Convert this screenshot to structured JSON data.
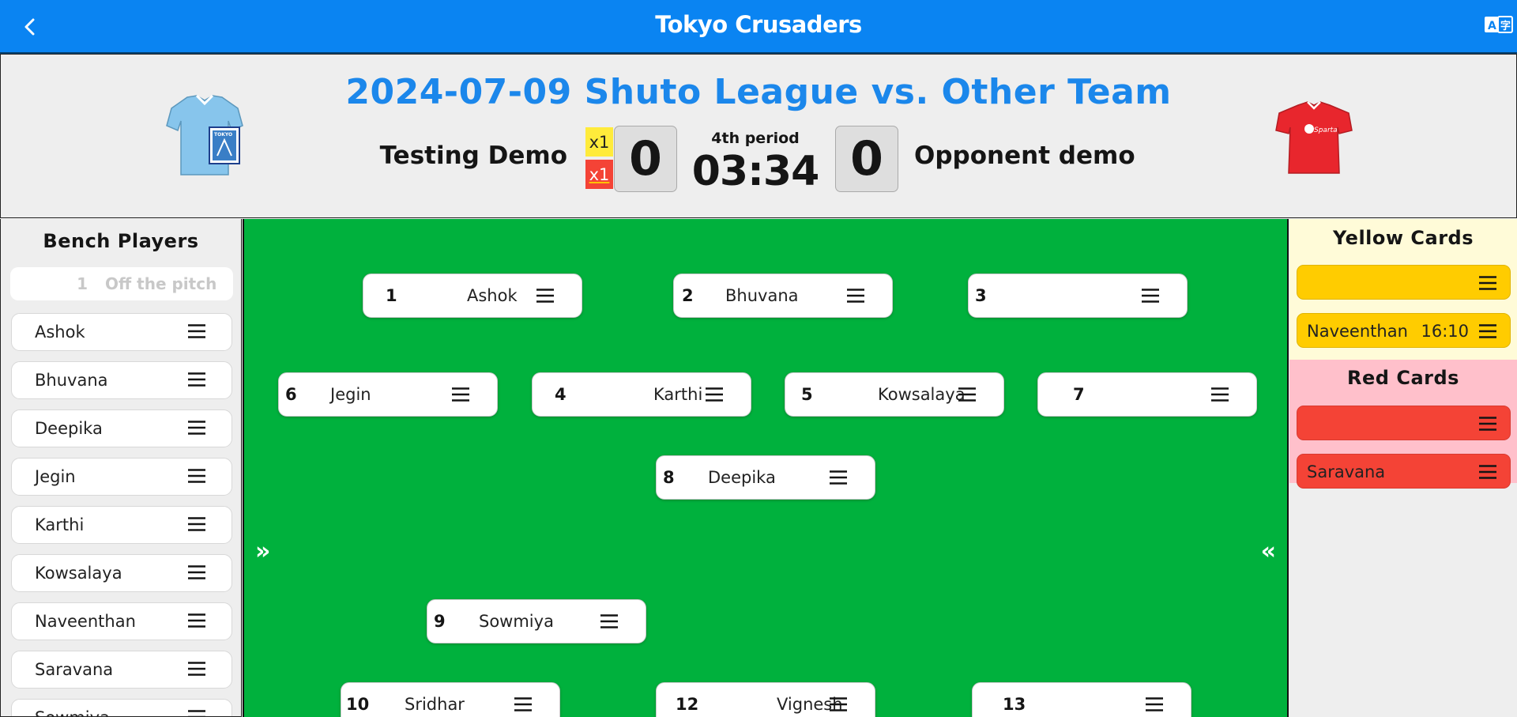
{
  "appbar": {
    "title": "Tokyo Crusaders",
    "back_icon": "chevron-left-icon",
    "translate_icon": "translate-icon"
  },
  "match": {
    "title": "2024-07-09 Shuto League vs. Other Team",
    "home_team": "Testing Demo",
    "away_team": "Opponent demo",
    "home_yellow_cards": "x1",
    "home_red_cards": "x1",
    "home_score": "0",
    "away_score": "0",
    "period": "4th period",
    "clock": "03:34",
    "home_jersey_color": "#87c5ec",
    "away_jersey_color": "#e8262d"
  },
  "bench": {
    "title": "Bench Players",
    "placeholder_number": "1",
    "placeholder_label": "Off the pitch",
    "players": [
      "Ashok",
      "Bhuvana",
      "Deepika",
      "Jegin",
      "Karthi",
      "Kowsalaya",
      "Naveenthan",
      "Saravana",
      "Sowmiya"
    ]
  },
  "pitch": {
    "color": "#00b13d",
    "right_arrow": "»",
    "left_arrow": "«",
    "slots": [
      {
        "number": "1",
        "name": "Ashok"
      },
      {
        "number": "2",
        "name": "Bhuvana"
      },
      {
        "number": "3",
        "name": ""
      },
      {
        "number": "6",
        "name": "Jegin"
      },
      {
        "number": "4",
        "name": "Karthi"
      },
      {
        "number": "5",
        "name": "Kowsalaya"
      },
      {
        "number": "7",
        "name": ""
      },
      {
        "number": "8",
        "name": "Deepika"
      },
      {
        "number": "9",
        "name": "Sowmiya"
      },
      {
        "number": "10",
        "name": "Sridhar"
      },
      {
        "number": "12",
        "name": "Vignesh"
      },
      {
        "number": "13",
        "name": ""
      }
    ]
  },
  "cards": {
    "yellow_title": "Yellow Cards",
    "red_title": "Red Cards",
    "yellow": [
      {
        "name": "",
        "time": ""
      },
      {
        "name": "Naveenthan",
        "time": "16:10"
      }
    ],
    "red": [
      {
        "name": "",
        "time": ""
      },
      {
        "name": "Saravana",
        "time": ""
      }
    ],
    "yellow_color": "#ffcc00",
    "red_color": "#f44336"
  }
}
